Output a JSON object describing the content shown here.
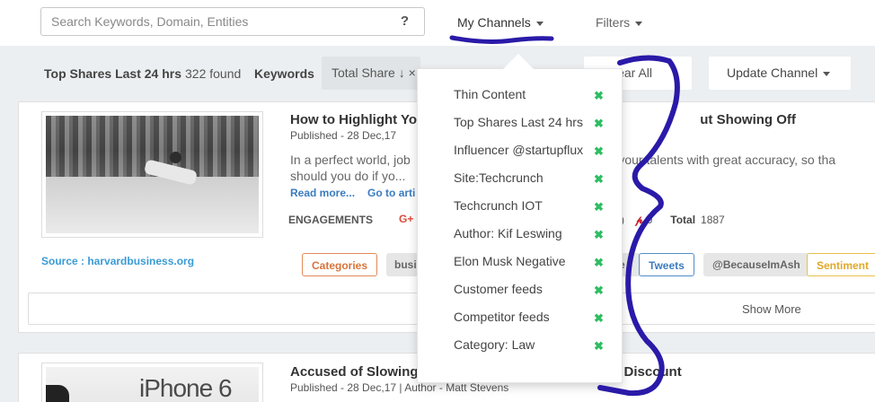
{
  "search": {
    "placeholder": "Search Keywords, Domain, Entities",
    "help_icon": "?"
  },
  "nav": {
    "my_channels": "My Channels",
    "filters": "Filters"
  },
  "resultbar": {
    "title": "Top Shares Last 24 hrs",
    "found": "322 found",
    "keywords": "Keywords",
    "sort_label": "Total Share",
    "sort_icon": "↓",
    "sort_suffix": "×",
    "clear_label": "lear All",
    "update_label": "Update Channel"
  },
  "articles": [
    {
      "title_left": "How to Highlight You",
      "title_right": "ut Showing Off",
      "published": "Published - 28 Dec,17",
      "excerpt_left": "In a perfect world, job",
      "excerpt_left2": "should you do if yo...",
      "excerpt_right": "ng your talents with great accuracy, so tha",
      "read_more": "Read more...",
      "go_to": "Go to arti",
      "engagements_label": "ENGAGEMENTS",
      "gplus_label": "G+",
      "right_count_prefix": ")",
      "pinterest_count": "0",
      "total_label": "Total",
      "total_value": "1887",
      "source": "Source : harvardbusiness.org",
      "tags": {
        "categories": "Categories",
        "business": "busin",
        "e": "e",
        "tweets": "Tweets",
        "handle": "@BecauseImAsh",
        "sentiment": "Sentiment"
      },
      "show_more": "Show More"
    },
    {
      "title_left": "Accused of Slowing C",
      "title_right": "Discount",
      "published": "Published - 28 Dec,17 | Author - Matt Stevens",
      "thumb_text": "iPhone 6"
    }
  ],
  "dropdown": {
    "items": [
      {
        "label": "Thin Content"
      },
      {
        "label": "Top Shares Last 24 hrs"
      },
      {
        "label": "Influencer @startupflux"
      },
      {
        "label": "Site:Techcrunch"
      },
      {
        "label": "Techcrunch IOT"
      },
      {
        "label": "Author: Kif Leswing"
      },
      {
        "label": "Elon Musk Negative"
      },
      {
        "label": "Customer feeds"
      },
      {
        "label": "Competitor feeds"
      },
      {
        "label": "Category: Law"
      }
    ],
    "remove_glyph": "✖"
  },
  "colors": {
    "accent_blue": "#3a7cc0",
    "remove_green": "#2ebd63",
    "annotation": "#2a1aa8"
  }
}
